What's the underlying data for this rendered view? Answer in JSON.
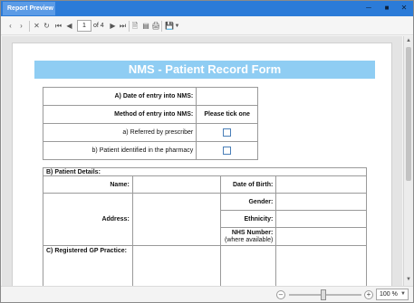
{
  "window": {
    "title": "Report Preview"
  },
  "toolbar": {
    "page_current": "1",
    "page_of": "of 4"
  },
  "form": {
    "title": "NMS - Patient Record Form",
    "section_a": {
      "date_label": "A) Date of entry into NMS:",
      "date_value": "",
      "method_label": "Method of entry into NMS:",
      "method_hint": "Please tick one",
      "options": [
        "a) Referred by prescriber",
        "b) Patient identified in the pharmacy"
      ]
    },
    "section_b": {
      "header": "B) Patient Details:",
      "name_label": "Name:",
      "dob_label": "Date of Birth:",
      "address_label": "Address:",
      "gender_label": "Gender:",
      "ethnicity_label": "Ethnicity:",
      "nhs_label": "NHS Number:",
      "nhs_hint": "(where available)"
    },
    "section_c": {
      "gp_label": "C) Registered GP Practice:"
    }
  },
  "statusbar": {
    "zoom": "100 %"
  },
  "colors": {
    "title_bar": "#2b7bd8",
    "form_header": "#8fcdf3"
  },
  "icons": [
    "back-icon",
    "forward-icon",
    "stop-icon",
    "refresh-icon",
    "first-page-icon",
    "prev-page-icon",
    "next-page-icon",
    "last-page-icon",
    "page-setup-icon",
    "layout-icon",
    "print-icon",
    "export-icon",
    "minimize-icon",
    "maximize-icon",
    "close-icon"
  ]
}
